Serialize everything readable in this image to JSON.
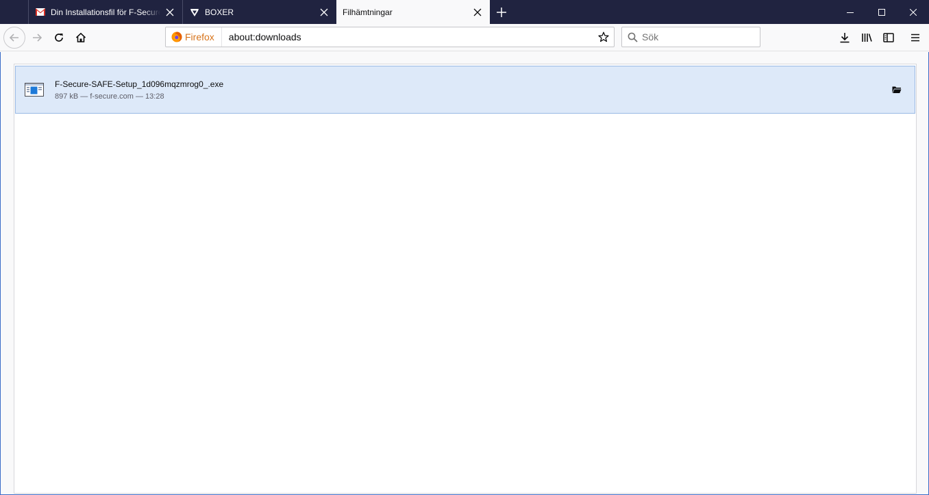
{
  "tabs": [
    {
      "title": "Din Installationsfil för F-Secure",
      "icon": "gmail-icon",
      "active": false
    },
    {
      "title": "BOXER",
      "icon": "boxer-shield-icon",
      "active": false
    },
    {
      "title": "Filhämtningar",
      "icon": "",
      "active": true
    }
  ],
  "navbar": {
    "identity_label": "Firefox",
    "url": "about:downloads",
    "search_placeholder": "Sök"
  },
  "downloads": [
    {
      "file_name": "F-Secure-SAFE-Setup_1d096mqzmrog0_.exe",
      "status": "897 kB — f-secure.com — 13:28",
      "icon": "exe-file-icon"
    }
  ],
  "colors": {
    "titlebar": "#202340",
    "selected_item_bg": "#dde9f9",
    "identity_label": "#d7731a"
  }
}
